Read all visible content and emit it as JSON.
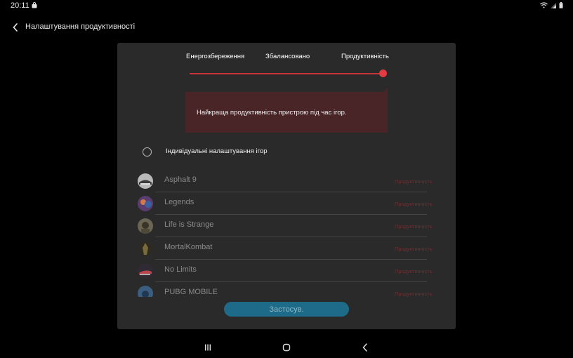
{
  "status_bar": {
    "time": "20:11"
  },
  "header": {
    "title": "Налаштування продуктивності"
  },
  "modes": {
    "energy": "Енергозбереження",
    "balanced": "Збалансовано",
    "performance": "Продуктивність",
    "selected_fraction": 1.0
  },
  "description": "Найкраща продуктивність пристрою під час ігор.",
  "custom_settings": {
    "label": "Індивідуальні налаштування ігор",
    "checked": false
  },
  "games": [
    {
      "name": "Asphalt 9",
      "mode": "Продуктивність"
    },
    {
      "name": "Legends",
      "mode": "Продуктивність"
    },
    {
      "name": "Life is Strange",
      "mode": "Продуктивність"
    },
    {
      "name": "MortalKombat",
      "mode": "Продуктивність"
    },
    {
      "name": "No Limits",
      "mode": "Продуктивність"
    },
    {
      "name": "PUBG MOBILE",
      "mode": "Продуктивність"
    }
  ],
  "apply_button": {
    "label": "Застосув."
  },
  "colors": {
    "accent": "#e33a43",
    "panel": "#2a2a2a",
    "apply": "#1d6b88"
  }
}
